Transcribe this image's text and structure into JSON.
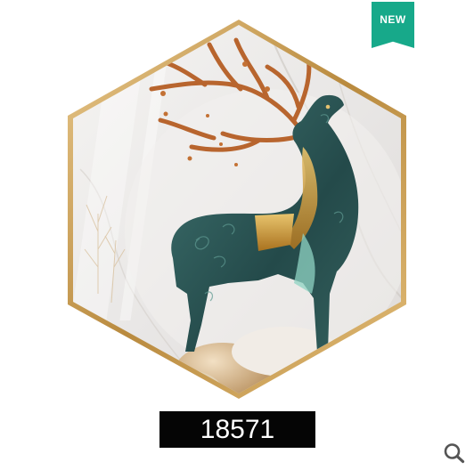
{
  "badge": {
    "label": "NEW",
    "color": "#17a98a"
  },
  "product": {
    "code": "18571"
  },
  "icons": {
    "zoom": "magnifier-icon"
  },
  "colors": {
    "frame_gold": "#c9a063",
    "marble": "#eeeceb",
    "deer_teal": "#2f5a58",
    "deer_gold": "#c7902e",
    "antler_copper": "#b8652e"
  }
}
